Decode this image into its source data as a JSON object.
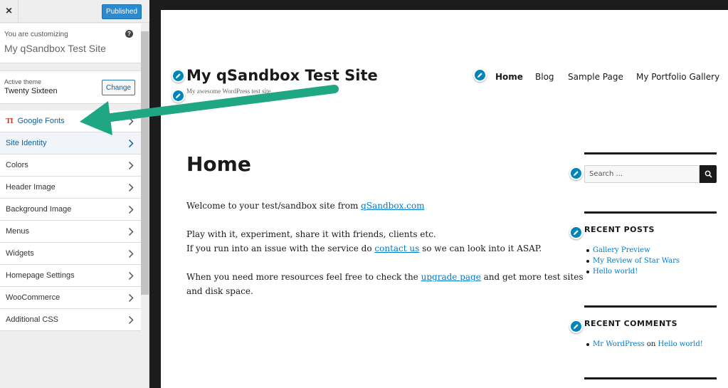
{
  "customizer": {
    "close_label": "×",
    "publish_label": "Published",
    "customizing_label": "You are customizing",
    "help_label": "?",
    "site_name": "My qSandbox Test Site",
    "active_theme_label": "Active theme",
    "theme_name": "Twenty Sixteen",
    "change_label": "Change",
    "google_fonts_icon": "TI",
    "menu_items": [
      "Google Fonts",
      "Site Identity",
      "Colors",
      "Header Image",
      "Background Image",
      "Menus",
      "Widgets",
      "Homepage Settings",
      "WooCommerce",
      "Additional CSS"
    ]
  },
  "site": {
    "title": "My qSandbox Test Site",
    "tagline": "My awesome WordPress test site",
    "nav": [
      "Home",
      "Blog",
      "Sample Page",
      "My Portfolio Gallery"
    ]
  },
  "page": {
    "heading": "Home",
    "p1_text": "Welcome to your test/sandbox site from ",
    "p1_link": "qSandbox.com",
    "p2_line1": "Play with it, experiment, share it with friends, clients etc.",
    "p2_line2_before": "If you run into an issue with the service do ",
    "p2_link": "contact us",
    "p2_line2_after": " so we can look into it ASAP.",
    "p3_before": "When you need more resources feel free to check the ",
    "p3_link": "upgrade page",
    "p3_after": " and get more test sites",
    "p3_line2": "and disk space."
  },
  "widgets": {
    "search_placeholder": "Search ...",
    "recent_posts_title": "RECENT POSTS",
    "recent_posts": [
      "Gallery Preview",
      "My Review of Star Wars",
      "Hello world!"
    ],
    "recent_comments_title": "RECENT COMMENTS",
    "comment_author": "Mr WordPress",
    "comment_on": " on ",
    "comment_post": "Hello world!"
  },
  "colors": {
    "accent": "#0085ba",
    "link": "#007acc",
    "arrow": "#1fa784",
    "publish": "#2a8bd0"
  },
  "icons": [
    "close-icon",
    "help-icon",
    "google-fonts-icon",
    "chevron-right-icon",
    "pencil-icon",
    "search-icon"
  ]
}
